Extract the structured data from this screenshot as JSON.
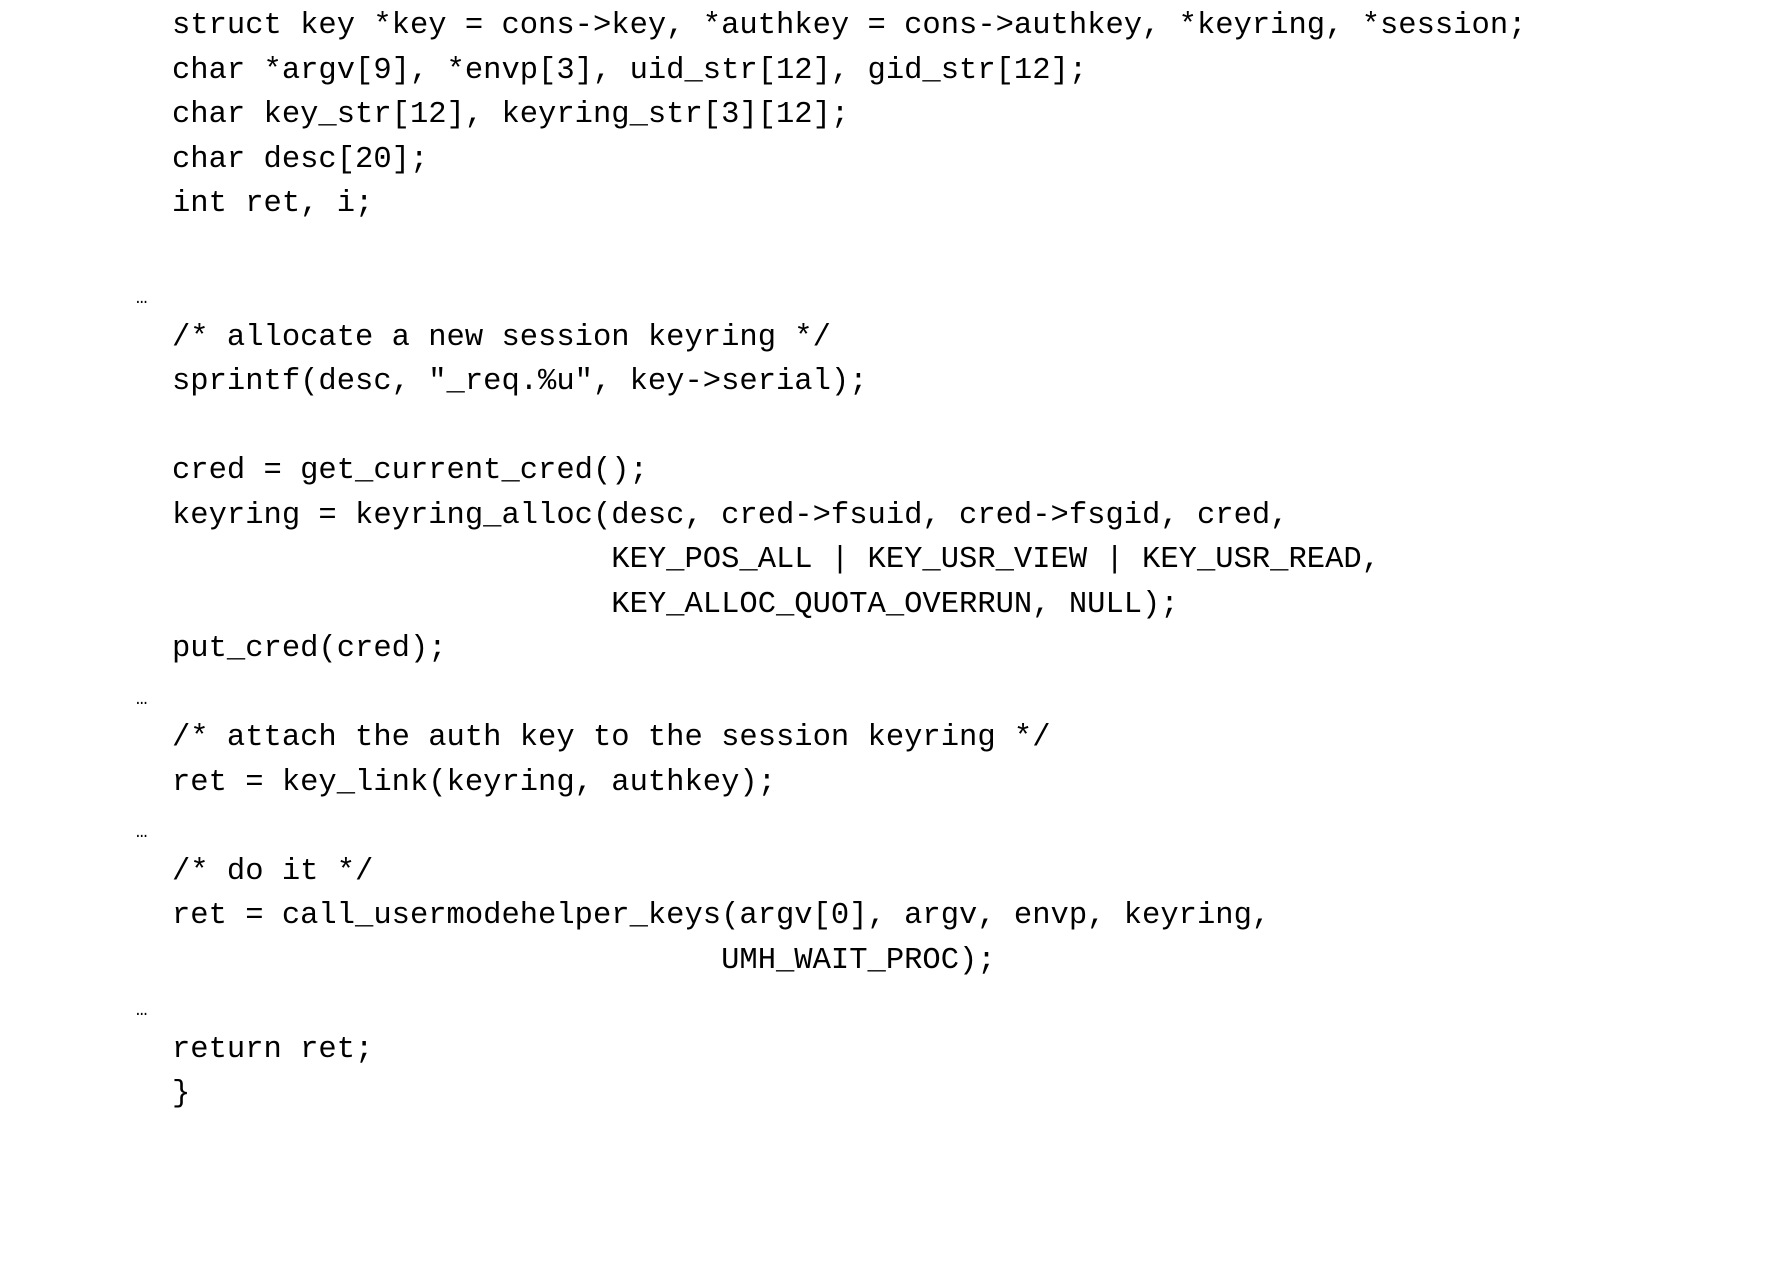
{
  "document": {
    "kind": "source-code-listing",
    "language": "c",
    "background_color": "#ffffff",
    "text_color": "#000000",
    "ellipsis_glyph": "…",
    "lines": [
      {
        "type": "code",
        "text": "struct key *key = cons->key, *authkey = cons->authkey, *keyring, *session;"
      },
      {
        "type": "code",
        "text": "char *argv[9], *envp[3], uid_str[12], gid_str[12];"
      },
      {
        "type": "code",
        "text": "char key_str[12], keyring_str[3][12];"
      },
      {
        "type": "code",
        "text": "char desc[20];"
      },
      {
        "type": "code",
        "text": "int ret, i;"
      },
      {
        "type": "blank",
        "text": ""
      },
      {
        "type": "ellipsis",
        "text": "…"
      },
      {
        "type": "code",
        "text": "/* allocate a new session keyring */"
      },
      {
        "type": "code",
        "text": "sprintf(desc, \"_req.%u\", key->serial);"
      },
      {
        "type": "blank",
        "text": ""
      },
      {
        "type": "code",
        "text": "cred = get_current_cred();"
      },
      {
        "type": "code",
        "text": "keyring = keyring_alloc(desc, cred->fsuid, cred->fsgid, cred,"
      },
      {
        "type": "code",
        "text": "                        KEY_POS_ALL | KEY_USR_VIEW | KEY_USR_READ,"
      },
      {
        "type": "code",
        "text": "                        KEY_ALLOC_QUOTA_OVERRUN, NULL);"
      },
      {
        "type": "code",
        "text": "put_cred(cred);"
      },
      {
        "type": "ellipsis",
        "text": "…"
      },
      {
        "type": "code",
        "text": "/* attach the auth key to the session keyring */"
      },
      {
        "type": "code",
        "text": "ret = key_link(keyring, authkey);"
      },
      {
        "type": "ellipsis",
        "text": "…"
      },
      {
        "type": "code",
        "text": "/* do it */"
      },
      {
        "type": "code",
        "text": "ret = call_usermodehelper_keys(argv[0], argv, envp, keyring,"
      },
      {
        "type": "code",
        "text": "                              UMH_WAIT_PROC);"
      },
      {
        "type": "ellipsis",
        "text": "…"
      },
      {
        "type": "code",
        "text": "return ret;"
      },
      {
        "type": "code",
        "text": "}"
      }
    ]
  }
}
